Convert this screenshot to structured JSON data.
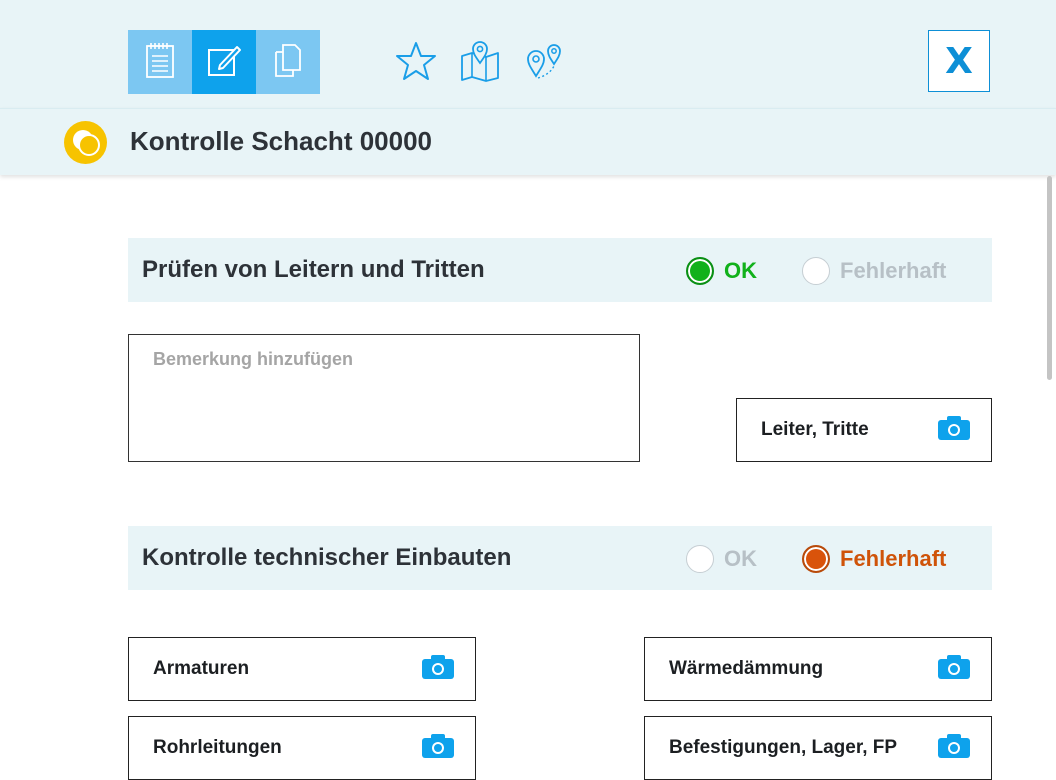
{
  "toolbar": {
    "tabs": [
      {
        "icon": "notepad-icon",
        "active": false
      },
      {
        "icon": "edit-icon",
        "active": true
      },
      {
        "icon": "documents-icon",
        "active": false
      }
    ],
    "tools": [
      "star-icon",
      "map-icon",
      "route-icon"
    ],
    "close_label": "X"
  },
  "header": {
    "title": "Kontrolle Schacht 00000",
    "status_color": "#f7c300"
  },
  "sections": [
    {
      "title": "Prüfen von Leitern und Tritten",
      "ok_label": "OK",
      "fault_label": "Fehlerhaft",
      "selected": "ok",
      "remark_placeholder": "Bemerkung hinzufügen",
      "photo_items": [
        "Leiter, Tritte"
      ]
    },
    {
      "title": "Kontrolle technischer Einbauten",
      "ok_label": "OK",
      "fault_label": "Fehlerhaft",
      "selected": "fault",
      "photo_items": [
        "Armaturen",
        "Wärmedämmung",
        "Rohrleitungen",
        "Befestigungen, Lager, FP"
      ]
    }
  ],
  "colors": {
    "accent": "#0ea2ec",
    "ok": "#11b11b",
    "fault": "#d9530b",
    "panel": "#e8f4f7"
  }
}
